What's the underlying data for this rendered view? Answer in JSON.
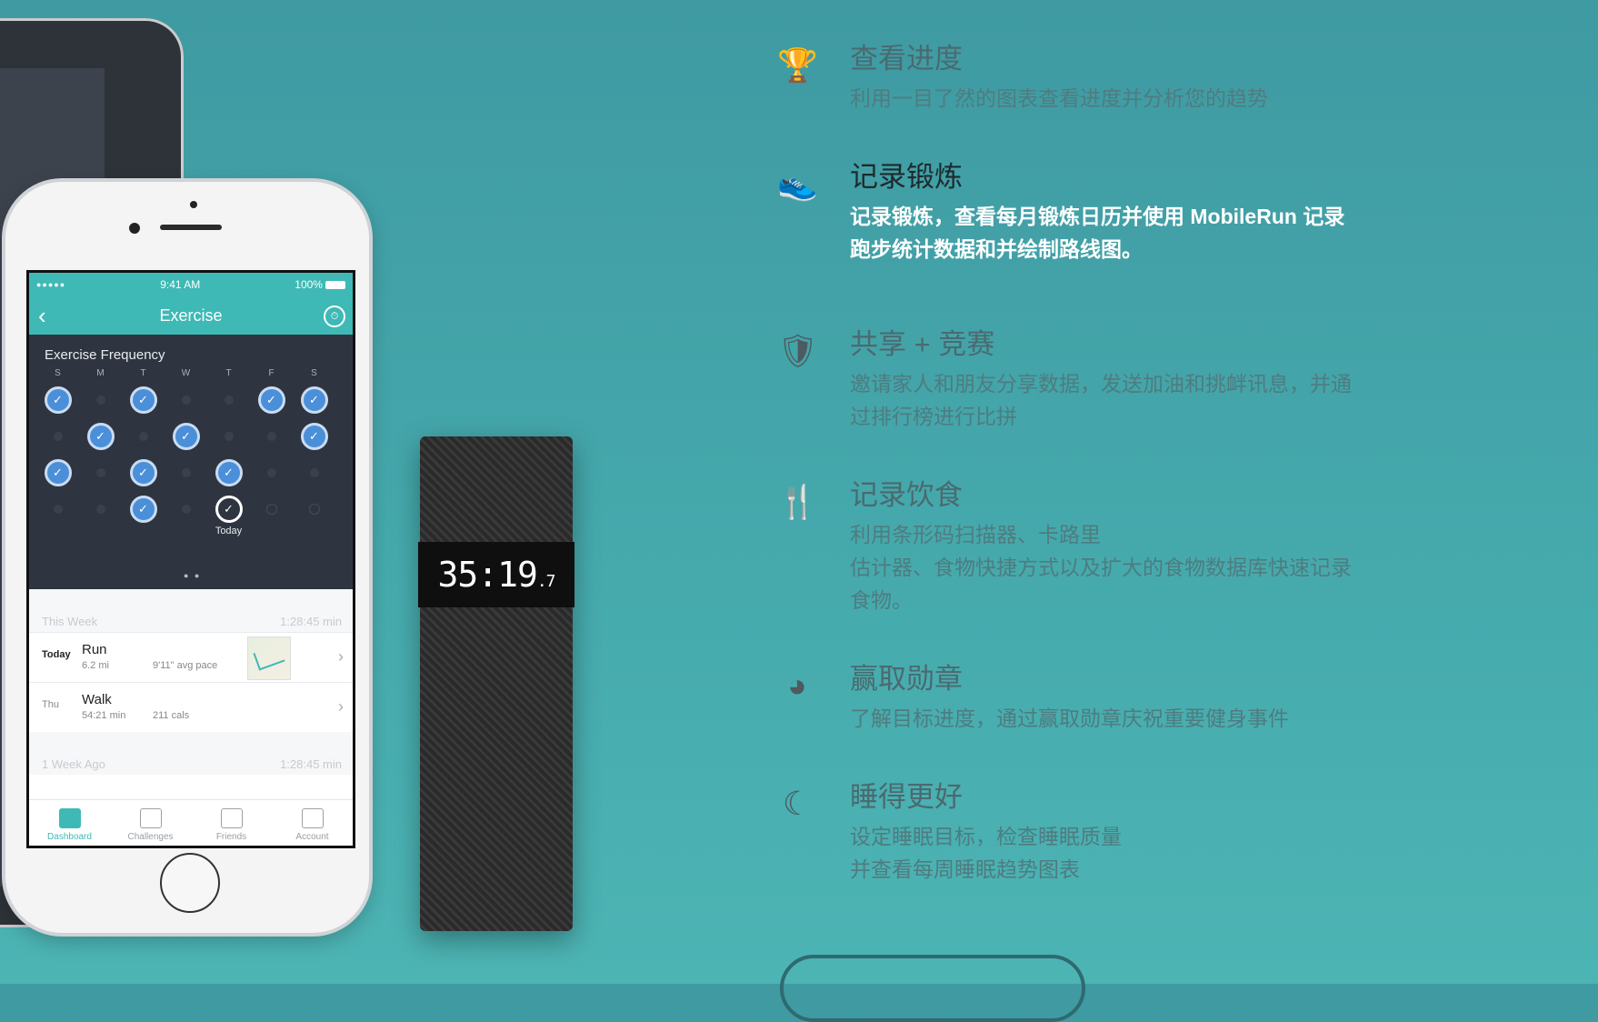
{
  "phone": {
    "status": {
      "signal": "●●●●● ",
      "time": "9:41 AM",
      "battery": "100%"
    },
    "nav": {
      "title": "Exercise"
    },
    "frequency": {
      "title": "Exercise Frequency",
      "days": [
        "S",
        "M",
        "T",
        "W",
        "T",
        "F",
        "S"
      ],
      "today_label": "Today",
      "rows": [
        [
          "check",
          "dot",
          "check",
          "dot",
          "dot",
          "check",
          "check"
        ],
        [
          "dot",
          "check",
          "dot",
          "check",
          "dot",
          "dot",
          "check"
        ],
        [
          "check",
          "dot",
          "check",
          "dot",
          "check",
          "dot",
          "dot"
        ],
        [
          "dot",
          "dot",
          "check",
          "dot",
          "today",
          "empty",
          "empty"
        ]
      ]
    },
    "this_week": {
      "label": "This Week",
      "total": "1:28:45 min"
    },
    "activities": [
      {
        "when": "Today",
        "name": "Run",
        "detail1": "6.2 mi",
        "detail2": "9'11\" avg pace"
      },
      {
        "when": "Thu",
        "name": "Walk",
        "detail1": "54:21 min",
        "detail2": "211 cals"
      }
    ],
    "week_ago": {
      "label": "1 Week Ago",
      "total": "1:28:45 min"
    },
    "tabs": [
      {
        "label": "Dashboard",
        "icon": "dashboard-icon"
      },
      {
        "label": "Challenges",
        "icon": "challenges-icon"
      },
      {
        "label": "Friends",
        "icon": "friends-icon"
      },
      {
        "label": "Account",
        "icon": "account-icon"
      }
    ]
  },
  "tracker": {
    "time_main": "35:19",
    "time_fraction": ".7"
  },
  "features": [
    {
      "icon": "trophy-icon",
      "title": "查看进度",
      "desc": "利用一目了然的图表查看进度并分析您的趋势"
    },
    {
      "icon": "shoe-icon",
      "title": "记录锻炼",
      "desc": "记录锻炼，查看每月锻炼日历并使用 MobileRun 记录\n跑步统计数据和并绘制路线图。"
    },
    {
      "icon": "shield-star-icon",
      "title": "共享 + 竞赛",
      "desc": "邀请家人和朋友分享数据，发送加油和挑衅讯息，并通\n过排行榜进行比拼"
    },
    {
      "icon": "fork-knife-icon",
      "title": "记录饮食",
      "desc": "利用条形码扫描器、卡路里\n估计器、食物快捷方式以及扩大的食物数据库快速记录\n食物。"
    },
    {
      "icon": "badge-icon",
      "title": "赢取勋章",
      "desc": "了解目标进度，通过赢取勋章庆祝重要健身事件"
    },
    {
      "icon": "moon-icon",
      "title": "睡得更好",
      "desc": "设定睡眠目标，检查睡眠质量\n并查看每周睡眠趋势图表"
    }
  ]
}
